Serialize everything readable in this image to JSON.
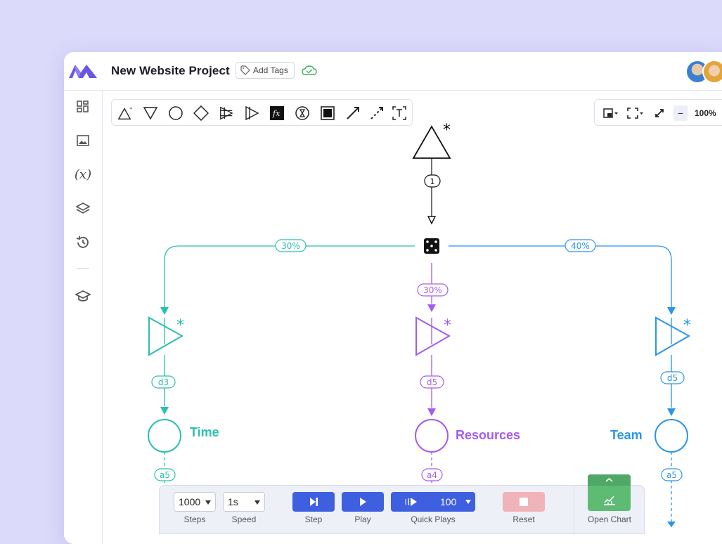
{
  "window": {
    "title": "New Website Project",
    "add_tags_label": "Add Tags",
    "zoom_level": "100%",
    "zoom_minus": "−"
  },
  "colors": {
    "background": "#dcdafa",
    "teal": "#2bbfae",
    "purple": "#a35cf0",
    "blue": "#2b95ea",
    "primary_button": "#3d5fe0",
    "reset_button": "#f0b3b8",
    "chart_button": "#5dbb73"
  },
  "sidebar": {
    "items": [
      {
        "icon": "dashboard-icon"
      },
      {
        "icon": "image-icon"
      },
      {
        "icon": "variable-icon",
        "label": "(x)"
      },
      {
        "icon": "layers-icon"
      },
      {
        "icon": "history-icon"
      },
      {
        "icon": "learn-icon"
      }
    ]
  },
  "toolbar": {
    "tools": [
      "source-tool-icon",
      "drain-tool-icon",
      "pool-tool-icon",
      "gate-tool-icon",
      "converter-tool-icon",
      "trader-tool-icon",
      "register-tool-icon",
      "delay-tool-icon",
      "end-condition-tool-icon",
      "resource-connection-icon",
      "state-connection-icon",
      "text-tool-icon"
    ]
  },
  "diagram": {
    "source_mark": "*",
    "flow_label": "1",
    "branches": [
      {
        "name": "Time",
        "percent": "30%",
        "delay": "d3",
        "activator": "a5",
        "mark": "*"
      },
      {
        "name": "Resources",
        "percent": "30%",
        "delay": "d5",
        "activator": "a4",
        "mark": "*"
      },
      {
        "name": "Team",
        "percent": "40%",
        "delay": "d5",
        "activator": "a5",
        "mark": "*"
      }
    ]
  },
  "controls": {
    "steps_value": "1000",
    "steps_label": "Steps",
    "speed_value": "1s",
    "speed_label": "Speed",
    "step_label": "Step",
    "play_label": "Play",
    "quick_plays_value": "100",
    "quick_plays_label": "Quick Plays",
    "reset_label": "Reset",
    "open_chart_label": "Open Chart"
  }
}
